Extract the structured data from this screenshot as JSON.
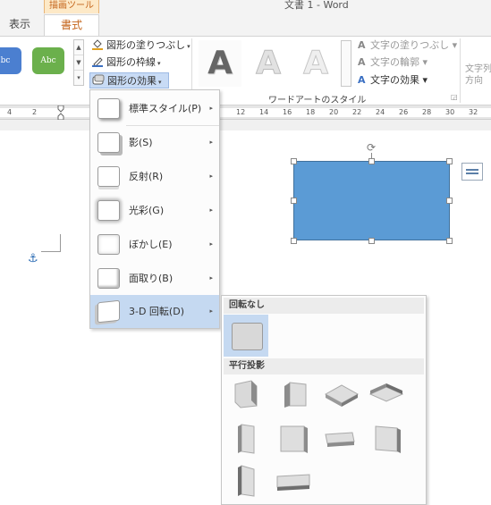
{
  "title_bar": {
    "context_label": "描画ツール",
    "document_title": "文書 1 - Word"
  },
  "tabs": [
    {
      "label": "表示"
    },
    {
      "label": "書式"
    }
  ],
  "ribbon": {
    "shape_styles": [
      {
        "label": "bc"
      },
      {
        "label": "Abc"
      }
    ],
    "shape_fill": "図形の塗りつぶし",
    "shape_outline": "図形の枠線",
    "shape_effects": "図形の効果",
    "wordart_group_label": "ワードアートのスタイル",
    "wordart_letters": [
      "A",
      "A",
      "A"
    ],
    "text_fill": "文字の塗りつぶし",
    "text_outline": "文字の輪郭",
    "text_effects": "文字の効果",
    "text_direction_1": "文字列",
    "text_direction_2": "方向"
  },
  "ruler": {
    "left_ticks": [
      "4",
      "2"
    ],
    "right_ticks": [
      "12",
      "14",
      "16",
      "18",
      "20",
      "22",
      "24",
      "26",
      "28",
      "30",
      "32"
    ]
  },
  "effects_menu": {
    "items": [
      {
        "label": "標準スタイル(P)",
        "icon": "preset-effect-icon"
      },
      {
        "label": "影(S)",
        "icon": "shadow-effect-icon"
      },
      {
        "label": "反射(R)",
        "icon": "reflection-effect-icon"
      },
      {
        "label": "光彩(G)",
        "icon": "glow-effect-icon"
      },
      {
        "label": "ぼかし(E)",
        "icon": "soft-edges-effect-icon"
      },
      {
        "label": "面取り(B)",
        "icon": "bevel-effect-icon"
      },
      {
        "label": "3-D 回転(D)",
        "icon": "3d-rotation-effect-icon"
      }
    ]
  },
  "rotation_submenu": {
    "no_rotation_header": "回転なし",
    "parallel_header": "平行投影"
  },
  "colors": {
    "shape_fill": "#5b9bd5",
    "menu_highlight": "#c5d9f1",
    "context_accent": "#c4641a"
  }
}
